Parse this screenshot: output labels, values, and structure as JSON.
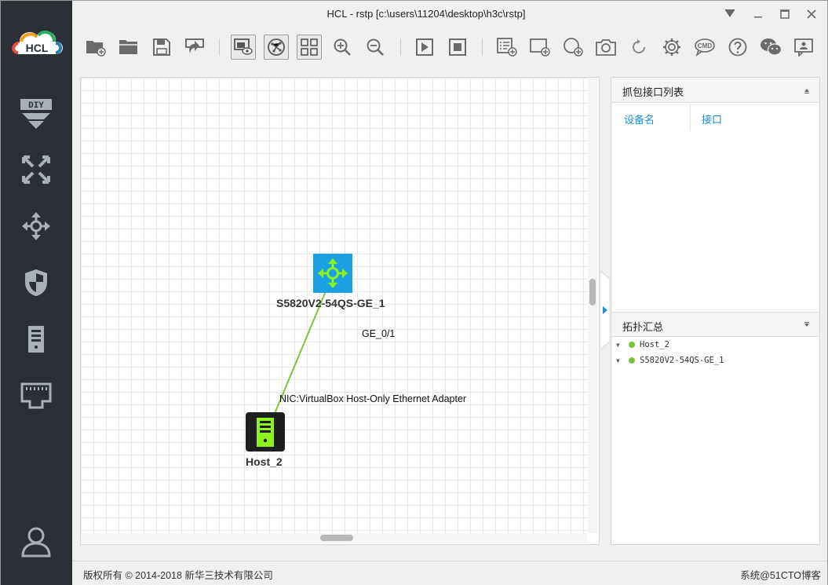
{
  "window": {
    "title": "HCL - rstp [c:\\users\\11204\\desktop\\h3c\\rstp]"
  },
  "sidebar": {
    "logo_text": "HCL",
    "items": [
      {
        "name": "diy",
        "icon": "diy-icon"
      },
      {
        "name": "router",
        "icon": "router-icon"
      },
      {
        "name": "switch",
        "icon": "switch-icon"
      },
      {
        "name": "firewall",
        "icon": "firewall-icon"
      },
      {
        "name": "host",
        "icon": "host-icon"
      },
      {
        "name": "cloud",
        "icon": "network-port-icon"
      },
      {
        "name": "user",
        "icon": "user-icon"
      }
    ]
  },
  "toolbar": {
    "buttons": [
      "new-project",
      "open-project",
      "save",
      "save-as",
      "show-labels",
      "topology-view",
      "grid",
      "zoom-in",
      "zoom-out",
      "start-all",
      "stop-all",
      "add-text",
      "add-rectangle",
      "add-ellipse",
      "screenshot",
      "refresh",
      "settings",
      "cmd",
      "help",
      "wechat",
      "feedback"
    ],
    "cmd_label": "CMD"
  },
  "topology": {
    "switch_label": "S5820V2-54QS-GE_1",
    "switch_port": "GE_0/1",
    "host_label": "Host_2",
    "host_port": "NIC:VirtualBox Host-Only Ethernet Adapter",
    "link_color": "#7cc23a"
  },
  "capture_panel": {
    "title": "抓包接口列表",
    "columns": [
      "设备名",
      "接口"
    ]
  },
  "topo_summary": {
    "title": "拓扑汇总",
    "items": [
      "Host_2",
      "S5820V2-54QS-GE_1"
    ]
  },
  "statusbar": {
    "copyright": "版权所有 © 2014-2018 新华三技术有限公司",
    "right_text": "系统@51CTO博客"
  },
  "colors": {
    "sidebar_bg": "#2b2f36",
    "accent_blue": "#1a8fd0",
    "status_green": "#79c23b",
    "switch_blue": "#1ba1e2"
  }
}
